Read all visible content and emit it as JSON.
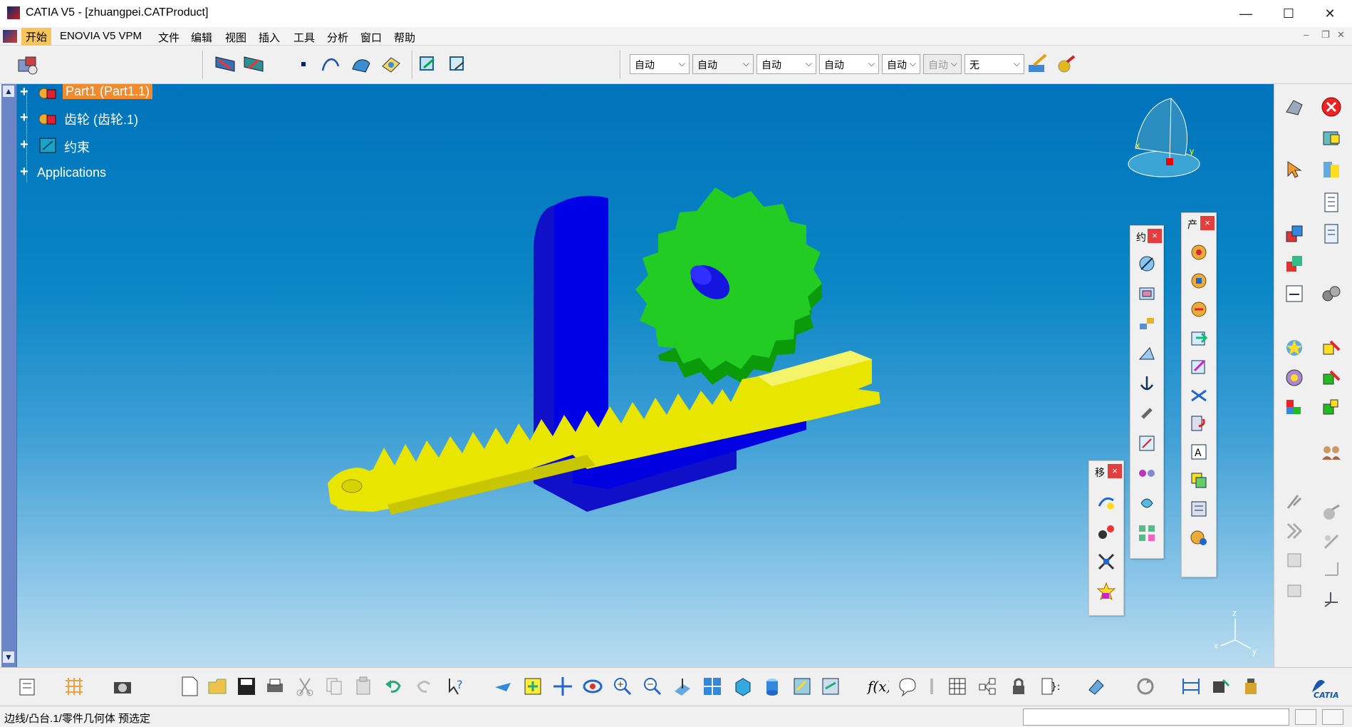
{
  "window": {
    "title": "CATIA V5 - [zhuangpei.CATProduct]",
    "minimize": "—",
    "maximize": "☐",
    "close": "✕"
  },
  "menu": {
    "items": [
      "开始",
      "ENOVIA V5 VPM",
      "文件",
      "编辑",
      "视图",
      "插入",
      "工具",
      "分析",
      "窗口",
      "帮助"
    ]
  },
  "toolbar": {
    "combos": [
      "自动",
      "自动",
      "自动",
      "自动",
      "自动",
      "自动",
      "无"
    ]
  },
  "tree": {
    "items": [
      "Part1 (Part1.1)",
      "齿轮 (齿轮.1)",
      "约束",
      "Applications"
    ]
  },
  "palettes": {
    "constraints_title": "约",
    "product_title": "产",
    "move_title": "移"
  },
  "status": {
    "text": "边线/凸台.1/零件几何体 预选定",
    "input_value": ""
  },
  "compass": {
    "x": "x",
    "y": "y",
    "z": "z"
  },
  "brand": {
    "logo_text": "CATIA"
  },
  "colors": {
    "part_blue": "#0000e0",
    "gear_green": "#22cc22",
    "rack_yellow": "#e8e600",
    "selected_highlight": "#f28a2e"
  }
}
